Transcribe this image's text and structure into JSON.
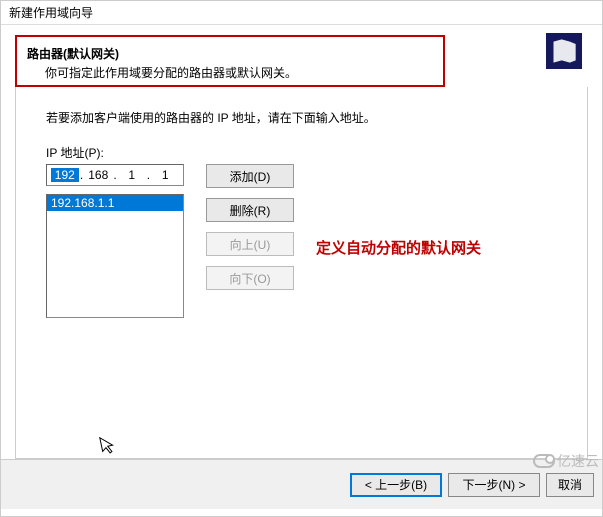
{
  "window": {
    "title": "新建作用域向导"
  },
  "header": {
    "title": "路由器(默认网关)",
    "subtitle": "你可指定此作用域要分配的路由器或默认网关。"
  },
  "instruction": "若要添加客户端使用的路由器的 IP 地址，请在下面输入地址。",
  "ip_field": {
    "label": "IP 地址(P):",
    "oct1": "192",
    "oct2": "168",
    "oct3": "1",
    "oct4": "1"
  },
  "buttons": {
    "add": "添加(D)",
    "remove": "删除(R)",
    "up": "向上(U)",
    "down": "向下(O)"
  },
  "list": {
    "item0": "192.168.1.1"
  },
  "annotation": "定义自动分配的默认网关",
  "footer": {
    "back": "< 上一步(B)",
    "next": "下一步(N) >",
    "cancel": "取消"
  },
  "watermark": "亿速云",
  "icon_box": {
    "name": "router-wizard-icon"
  }
}
